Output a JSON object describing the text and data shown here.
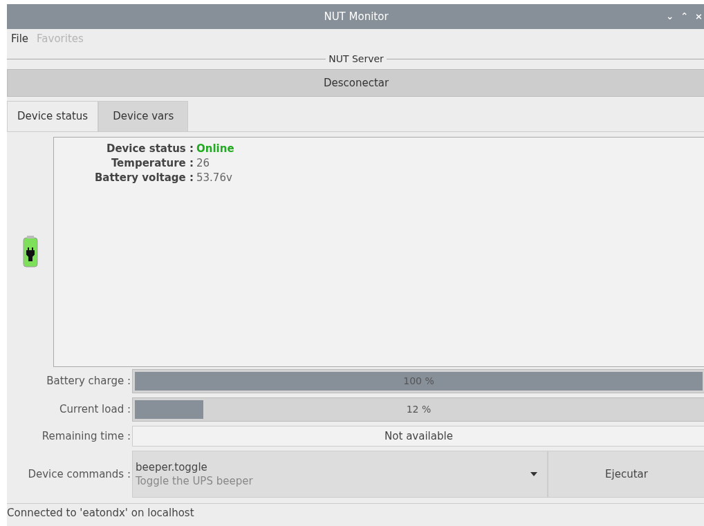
{
  "window": {
    "title": "NUT Monitor",
    "controls": [
      "⌄",
      "⌃",
      "×"
    ]
  },
  "menu": [
    {
      "label": "File",
      "disabled": false
    },
    {
      "label": "Favorites",
      "disabled": true
    }
  ],
  "server_frame": {
    "title": "NUT Server",
    "button": "Desconectar"
  },
  "tabs": [
    {
      "label": "Device status",
      "selected": true
    },
    {
      "label": "Device vars",
      "selected": false
    }
  ],
  "status_lines": [
    {
      "label": "Device status :",
      "value": "Online",
      "kind": "status",
      "color": "#22aa22"
    },
    {
      "label": "Temperature :",
      "value": "26",
      "kind": "plain"
    },
    {
      "label": "Battery voltage :",
      "value": "53.76v",
      "kind": "plain"
    }
  ],
  "meters": [
    {
      "label": "Battery charge :",
      "reading": "100 %",
      "level": 1.0,
      "kind": "bar"
    },
    {
      "label": "Current load :",
      "reading": "12 %",
      "level": 0.12,
      "kind": "bar"
    },
    {
      "label": "Remaining time :",
      "reading": "Not available",
      "kind": "text"
    }
  ],
  "commands": {
    "label": "Device commands :",
    "value": "beeper.toggle",
    "description": "Toggle the UPS beeper",
    "button": "Ejecutar"
  },
  "status_bar": "Connected to 'eatondx' on localhost"
}
